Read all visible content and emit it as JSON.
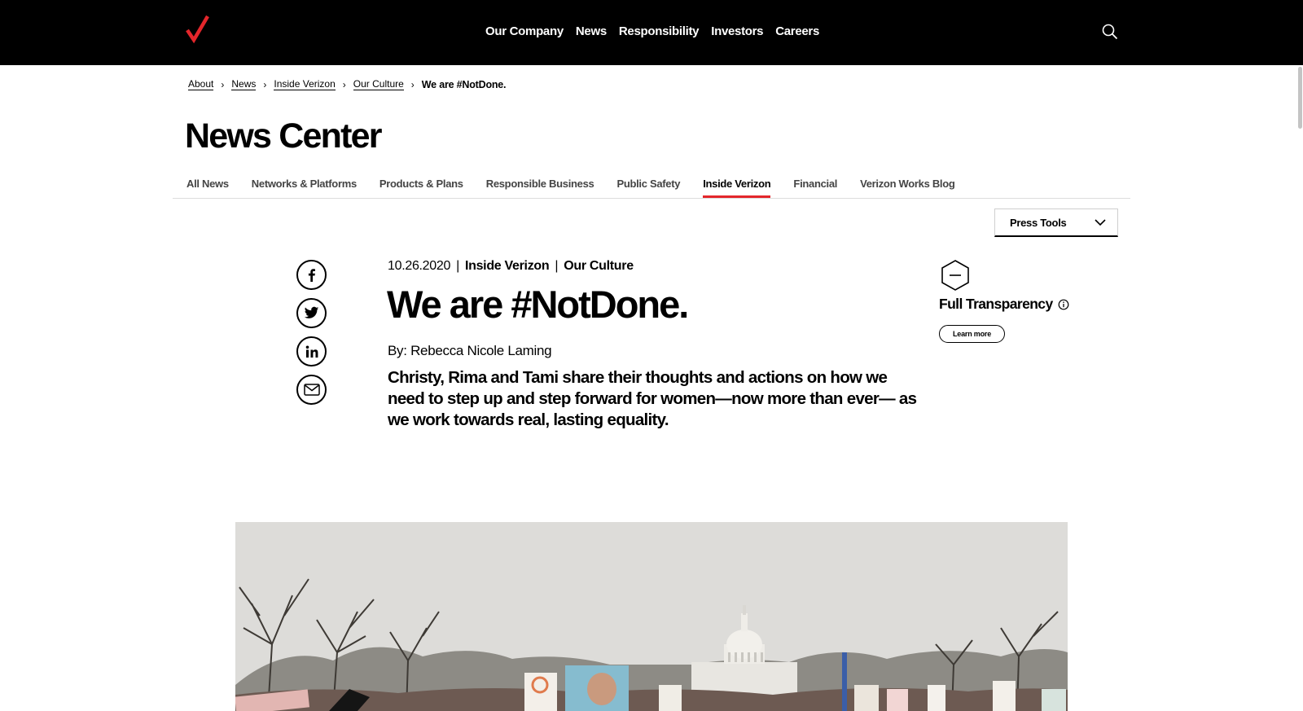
{
  "header": {
    "nav": [
      "Our Company",
      "News",
      "Responsibility",
      "Investors",
      "Careers"
    ],
    "brand_color": "#e3262b"
  },
  "breadcrumb": {
    "items": [
      "About",
      "News",
      "Inside Verizon",
      "Our Culture"
    ],
    "current": "We are #NotDone."
  },
  "page_title": "News Center",
  "tabs": {
    "items": [
      "All News",
      "Networks & Platforms",
      "Products & Plans",
      "Responsible Business",
      "Public Safety",
      "Inside Verizon",
      "Financial",
      "Verizon Works Blog"
    ],
    "active": "Inside Verizon"
  },
  "press_tools": {
    "label": "Press Tools"
  },
  "social": [
    "facebook-icon",
    "twitter-icon",
    "linkedin-icon",
    "email-icon"
  ],
  "article": {
    "date": "10.26.2020",
    "category": "Inside Verizon",
    "subcategory": "Our Culture",
    "headline": "We are #NotDone.",
    "byline": "By: Rebecca Nicole Laming",
    "summary": "Christy, Rima and Tami share their thoughts and actions on how we need to step up and step forward for women—now more than ever— as we work towards real, lasting equality."
  },
  "transparency": {
    "title": "Full Transparency",
    "button": "Learn more"
  }
}
